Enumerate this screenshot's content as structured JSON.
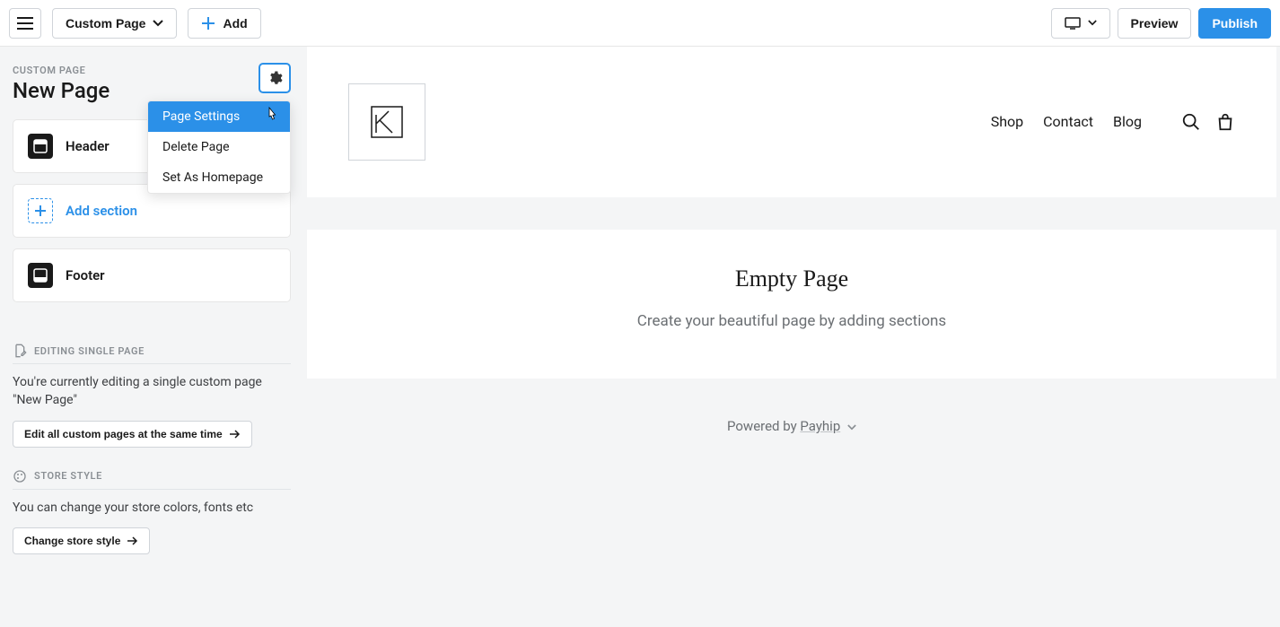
{
  "topbar": {
    "page_type_label": "Custom Page",
    "add_label": "Add",
    "preview_label": "Preview",
    "publish_label": "Publish"
  },
  "sidebar": {
    "overline": "CUSTOM PAGE",
    "page_title": "New Page",
    "menu": {
      "page_settings": "Page Settings",
      "delete_page": "Delete Page",
      "set_homepage": "Set As Homepage"
    },
    "sections": {
      "header": "Header",
      "add_section": "Add section",
      "footer": "Footer"
    },
    "editing_single": {
      "heading": "EDITING SINGLE PAGE",
      "body": "You're currently editing a single custom page \"New Page\"",
      "button": "Edit all custom pages at the same time"
    },
    "store_style": {
      "heading": "STORE STYLE",
      "body": "You can change your store colors, fonts etc",
      "button": "Change store style"
    }
  },
  "site": {
    "nav": {
      "shop": "Shop",
      "contact": "Contact",
      "blog": "Blog"
    },
    "empty_title": "Empty Page",
    "empty_sub": "Create your beautiful page by adding sections",
    "powered_prefix": "Powered by ",
    "powered_brand": "Payhip"
  }
}
